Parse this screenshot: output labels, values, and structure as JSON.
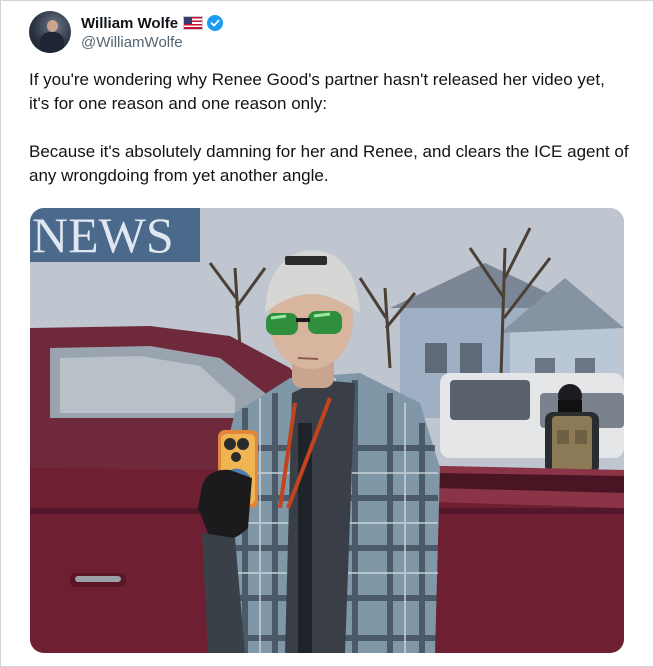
{
  "author": {
    "name": "William Wolfe",
    "handle": "@WilliamWolfe",
    "avatar_icon": "profile-photo",
    "flag_icon": "us-flag-icon",
    "verified_icon": "verified-badge-icon",
    "verified_color": "#1d9bf0"
  },
  "tweet": {
    "paragraph1": "If you're wondering why Renee Good's partner hasn't released her video yet, it's for one reason and one reason only:",
    "paragraph2": "Because it's absolutely damning for her and Renee, and clears the ICE agent of any wrongdoing from yet another angle."
  },
  "media": {
    "watermark": "NEWS"
  }
}
